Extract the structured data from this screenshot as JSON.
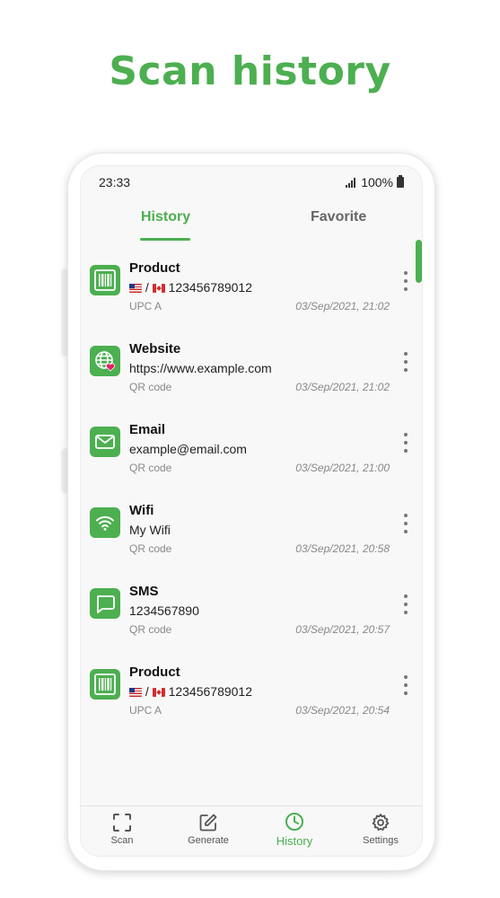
{
  "headline": "Scan history",
  "status_bar": {
    "time": "23:33",
    "battery": "100%"
  },
  "tabs": [
    {
      "label": "History",
      "active": true
    },
    {
      "label": "Favorite",
      "active": false
    }
  ],
  "colors": {
    "accent": "#4caf50",
    "heart": "#e91e63"
  },
  "history": [
    {
      "icon": "barcode-icon",
      "title": "Product",
      "flags": [
        "US",
        "CA"
      ],
      "separator": "/",
      "value": "123456789012",
      "type": "UPC A",
      "date": "03/Sep/2021, 21:02"
    },
    {
      "icon": "globe-favorite-icon",
      "title": "Website",
      "value": "https://www.example.com",
      "type": "QR code",
      "date": "03/Sep/2021, 21:02"
    },
    {
      "icon": "envelope-icon",
      "title": "Email",
      "value": "example@email.com",
      "type": "QR code",
      "date": "03/Sep/2021, 21:00"
    },
    {
      "icon": "wifi-icon",
      "title": "Wifi",
      "value": "My Wifi",
      "type": "QR code",
      "date": "03/Sep/2021, 20:58"
    },
    {
      "icon": "chat-bubble-icon",
      "title": "SMS",
      "value": "1234567890",
      "type": "QR code",
      "date": "03/Sep/2021, 20:57"
    },
    {
      "icon": "barcode-icon",
      "title": "Product",
      "flags": [
        "US",
        "CA"
      ],
      "separator": "/",
      "value": "123456789012",
      "type": "UPC A",
      "date": "03/Sep/2021, 20:54"
    }
  ],
  "bottom_nav": [
    {
      "label": "Scan",
      "icon": "scan-frame-icon",
      "active": false
    },
    {
      "label": "Generate",
      "icon": "pencil-square-icon",
      "active": false
    },
    {
      "label": "History",
      "icon": "clock-icon",
      "active": true
    },
    {
      "label": "Settings",
      "icon": "gear-icon",
      "active": false
    }
  ]
}
